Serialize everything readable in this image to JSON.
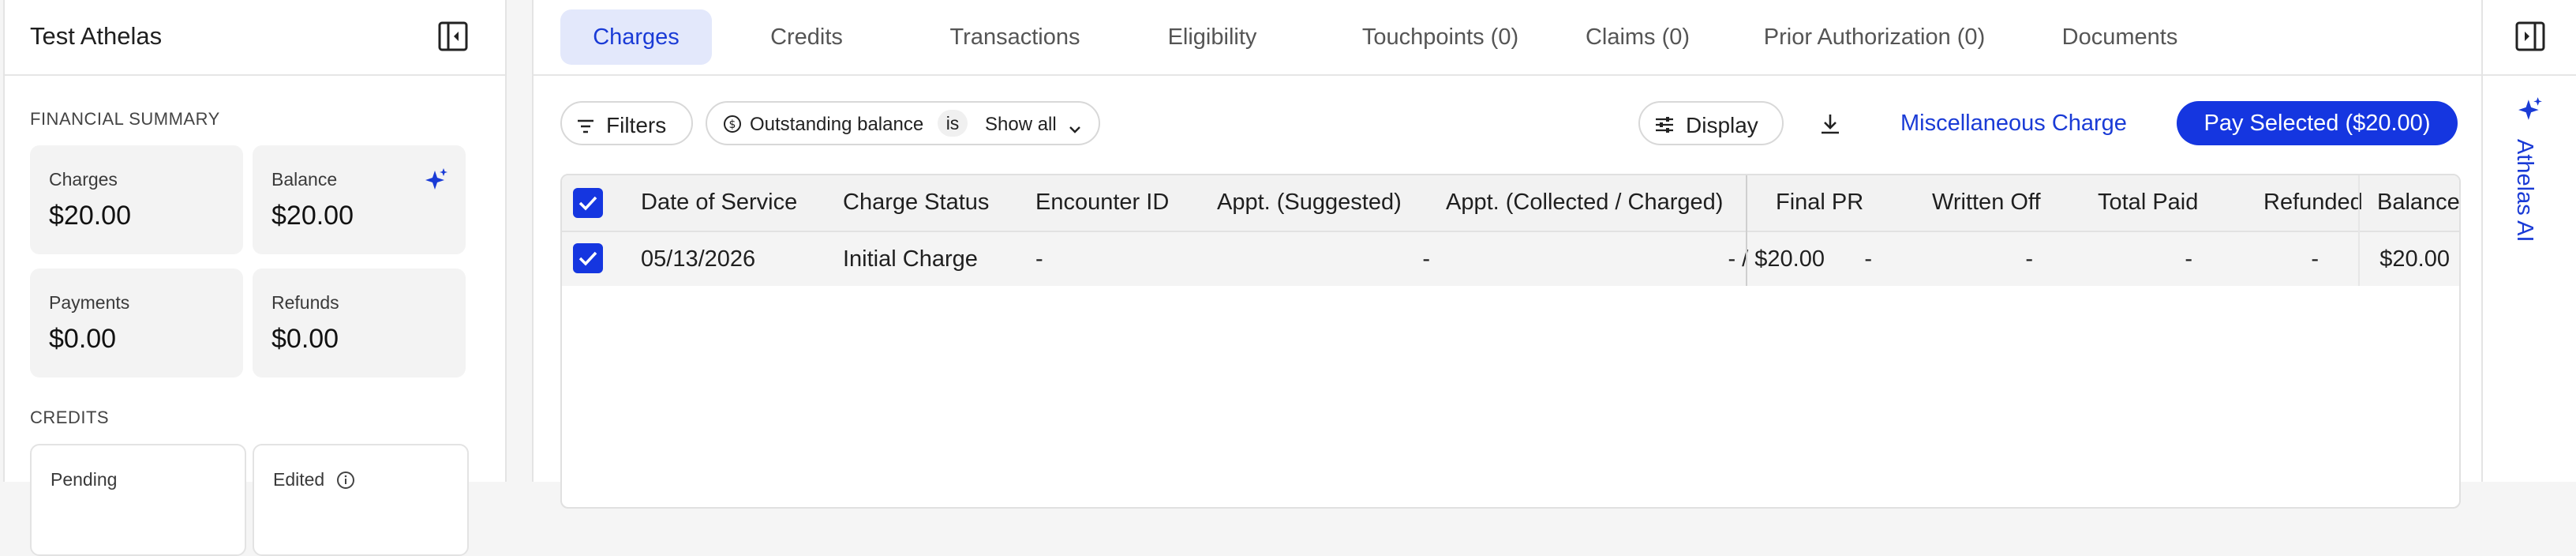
{
  "left_panel": {
    "title": "Test Athelas",
    "financial_summary_label": "FINANCIAL SUMMARY",
    "cards": [
      {
        "label": "Charges",
        "value": "$20.00"
      },
      {
        "label": "Balance",
        "value": "$20.00"
      },
      {
        "label": "Payments",
        "value": "$0.00"
      },
      {
        "label": "Refunds",
        "value": "$0.00"
      }
    ],
    "credits_label": "CREDITS",
    "credit_cards": [
      {
        "label": "Pending"
      },
      {
        "label": "Edited"
      }
    ]
  },
  "tabs": [
    {
      "label": "Charges",
      "active": true
    },
    {
      "label": "Credits"
    },
    {
      "label": "Transactions"
    },
    {
      "label": "Eligibility"
    },
    {
      "label": "Touchpoints (0)"
    },
    {
      "label": "Claims (0)"
    },
    {
      "label": "Prior Authorization (0)"
    },
    {
      "label": "Documents"
    }
  ],
  "toolbar": {
    "filters_label": "Filters",
    "filter_field": "Outstanding balance",
    "filter_operator": "is",
    "filter_value": "Show all",
    "display_label": "Display",
    "misc_charge_label": "Miscellaneous Charge",
    "pay_selected_label": "Pay Selected ($20.00)"
  },
  "table": {
    "columns": [
      "Date of Service",
      "Charge Status",
      "Encounter ID",
      "Appt. (Suggested)",
      "Appt. (Collected / Charged)",
      "Final PR",
      "Written Off",
      "Total Paid",
      "Refunded",
      "Balance"
    ],
    "rows": [
      {
        "date_of_service": "05/13/2026",
        "charge_status": "Initial Charge",
        "encounter_id": "-",
        "appt_suggested": "-",
        "appt_collected_charged": "- / $20.00",
        "final_pr": "-",
        "written_off": "-",
        "total_paid": "-",
        "refunded": "-",
        "balance": "$20.00"
      }
    ]
  },
  "right_rail": {
    "ai_label": "Athelas AI"
  },
  "colors": {
    "accent": "#1536e0",
    "accent_text": "#1a3bd6",
    "active_tab_bg": "#e3e8fb"
  }
}
